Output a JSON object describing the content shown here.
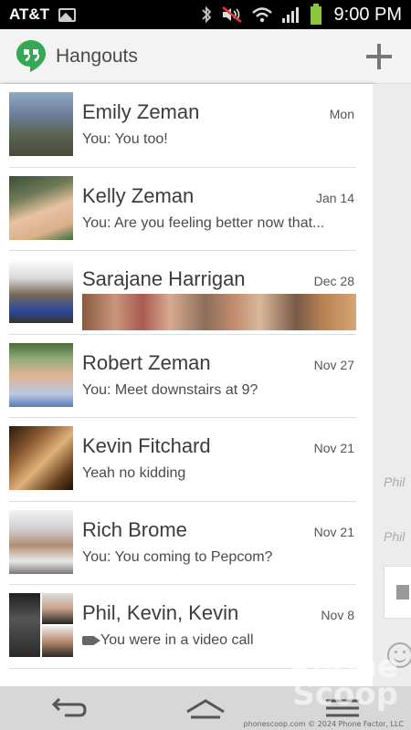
{
  "status_bar": {
    "carrier": "AT&T",
    "time": "9:00 PM",
    "icons": [
      "image-notification-icon",
      "bluetooth-icon",
      "mute-icon",
      "wifi-icon",
      "signal-icon",
      "battery-icon"
    ]
  },
  "app_bar": {
    "title": "Hangouts",
    "brand_color": "#34a853",
    "add_icon": "add-icon"
  },
  "conversations": [
    {
      "name": "Emily Zeman",
      "date": "Mon",
      "snippet": "You: You too!"
    },
    {
      "name": "Kelly Zeman",
      "date": "Jan 14",
      "snippet": "You: Are you feeling better now that..."
    },
    {
      "name": "Sarajane Harrigan",
      "date": "Dec 28",
      "snippet": ""
    },
    {
      "name": "Robert Zeman",
      "date": "Nov 27",
      "snippet": "You: Meet downstairs at 9?"
    },
    {
      "name": "Kevin Fitchard",
      "date": "Nov 21",
      "snippet": "Yeah no kidding"
    },
    {
      "name": "Rich Brome",
      "date": "Nov 21",
      "snippet": "You: You coming to Pepcom?"
    },
    {
      "name": "Phil, Kevin, Kevin",
      "date": "Nov 8",
      "snippet": "You were in a video call"
    }
  ],
  "right_pane": {
    "label_1": "Phil",
    "label_2": "Phil"
  },
  "nav_bar": {
    "icons": [
      "back-icon",
      "home-icon",
      "menu-icon"
    ]
  },
  "watermark": {
    "logo_line1": "Phone",
    "logo_line2": "Scoop",
    "footer": "phonescoop.com © 2024 Phone Factor, LLC"
  }
}
